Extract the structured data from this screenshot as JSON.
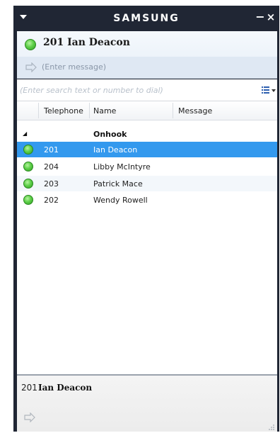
{
  "app": {
    "brand": "SAMSUNG"
  },
  "window_controls": {
    "minimize": "−",
    "close": "×"
  },
  "self": {
    "title": "201 Ian Deacon",
    "message": "(Enter message)",
    "status": "available"
  },
  "search": {
    "placeholder": "(Enter search text or number to dial)",
    "value": ""
  },
  "columns": {
    "telephone": "Telephone",
    "name": "Name",
    "message": "Message"
  },
  "group": {
    "label": "Onhook",
    "toggle": "◢"
  },
  "contacts": [
    {
      "ext": "201",
      "name": "Ian Deacon",
      "message": "",
      "status": "available",
      "selected": true
    },
    {
      "ext": "204",
      "name": "Libby McIntyre",
      "message": "",
      "status": "available",
      "selected": false
    },
    {
      "ext": "203",
      "name": "Patrick Mace",
      "message": "",
      "status": "available",
      "selected": false
    },
    {
      "ext": "202",
      "name": "Wendy Rowell",
      "message": "",
      "status": "available",
      "selected": false
    }
  ],
  "detail": {
    "ext": "201",
    "name": "Ian Deacon"
  },
  "colors": {
    "selection": "#3399ee",
    "titlebar": "#202634",
    "status_available": "#5fd04a"
  }
}
